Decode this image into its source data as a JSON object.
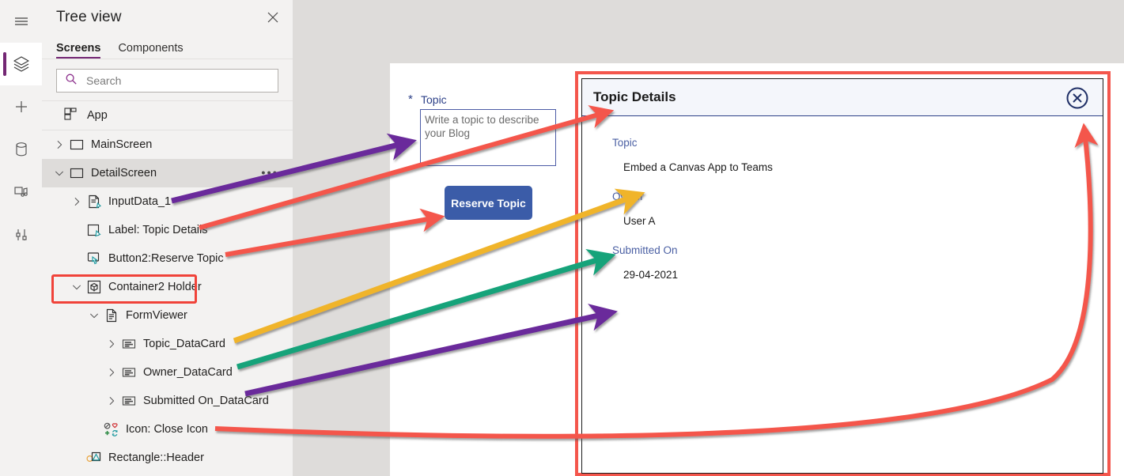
{
  "rail": {
    "items": [
      {
        "name": "hamburger-menu",
        "label": "Menu"
      },
      {
        "name": "tree-view",
        "label": "Tree view"
      },
      {
        "name": "insert",
        "label": "Insert"
      },
      {
        "name": "data",
        "label": "Data"
      },
      {
        "name": "media",
        "label": "Media"
      },
      {
        "name": "advanced-tools",
        "label": "Advanced tools"
      }
    ]
  },
  "tree": {
    "title": "Tree view",
    "close_label": "Close",
    "tabs": [
      {
        "label": "Screens",
        "active": true
      },
      {
        "label": "Components",
        "active": false
      }
    ],
    "search": {
      "placeholder": "Search",
      "value": ""
    },
    "app_row": {
      "label": "App",
      "icon": "app-icon"
    },
    "nodes": [
      {
        "label": "MainScreen",
        "indent": 0,
        "chevron": "right",
        "icon": "screen-icon",
        "selected": false,
        "ellipsis": false,
        "highlight": false
      },
      {
        "label": "DetailScreen",
        "indent": 0,
        "chevron": "down",
        "icon": "screen-icon",
        "selected": true,
        "ellipsis": true,
        "highlight": false
      },
      {
        "label": "InputData_1",
        "indent": 1,
        "chevron": "right",
        "icon": "textinput-icon",
        "selected": false,
        "ellipsis": false,
        "highlight": false
      },
      {
        "label": "Label: Topic Details",
        "indent": 1,
        "chevron": "none",
        "icon": "label-icon",
        "selected": false,
        "ellipsis": false,
        "highlight": false
      },
      {
        "label": "Button2:Reserve Topic",
        "indent": 1,
        "chevron": "none",
        "icon": "button-icon",
        "selected": false,
        "ellipsis": false,
        "highlight": false
      },
      {
        "label": "Container2 Holder",
        "indent": 1,
        "chevron": "down",
        "icon": "container-icon",
        "selected": false,
        "ellipsis": false,
        "highlight": true
      },
      {
        "label": "FormViewer",
        "indent": 2,
        "chevron": "down",
        "icon": "form-icon",
        "selected": false,
        "ellipsis": false,
        "highlight": false
      },
      {
        "label": "Topic_DataCard",
        "indent": 3,
        "chevron": "right",
        "icon": "datacard-icon",
        "selected": false,
        "ellipsis": false,
        "highlight": false
      },
      {
        "label": "Owner_DataCard",
        "indent": 3,
        "chevron": "right",
        "icon": "datacard-icon",
        "selected": false,
        "ellipsis": false,
        "highlight": false
      },
      {
        "label": "Submitted On_DataCard",
        "indent": 3,
        "chevron": "right",
        "icon": "datacard-icon",
        "selected": false,
        "ellipsis": false,
        "highlight": false
      },
      {
        "label": "Icon: Close Icon",
        "indent": 2,
        "chevron": "none",
        "icon": "icons-icon",
        "selected": false,
        "ellipsis": false,
        "highlight": false
      },
      {
        "label": "Rectangle::Header",
        "indent": 1,
        "chevron": "none",
        "icon": "shape-icon",
        "selected": false,
        "ellipsis": false,
        "highlight": false
      }
    ]
  },
  "canvas": {
    "topic_field": {
      "required_marker": "*",
      "label": "Topic",
      "placeholder": "Write a topic to describe your Blog",
      "value": ""
    },
    "reserve_button": {
      "label": "Reserve Topic"
    }
  },
  "dialog": {
    "title": "Topic Details",
    "close_label": "Close",
    "fields": [
      {
        "label": "Topic",
        "value": "Embed a Canvas App to Teams"
      },
      {
        "label": "Owner",
        "value": "User A"
      },
      {
        "label": "Submitted On",
        "value": "29-04-2021"
      }
    ]
  },
  "colors": {
    "accent_purple": "#742774",
    "annotation_red": "#f4564c",
    "annotation_purple": "#6a2b9b",
    "annotation_orange": "#f0b429",
    "annotation_teal": "#12a37a",
    "button_blue": "#3b5ca8",
    "field_label_blue": "#4a5fa3"
  }
}
